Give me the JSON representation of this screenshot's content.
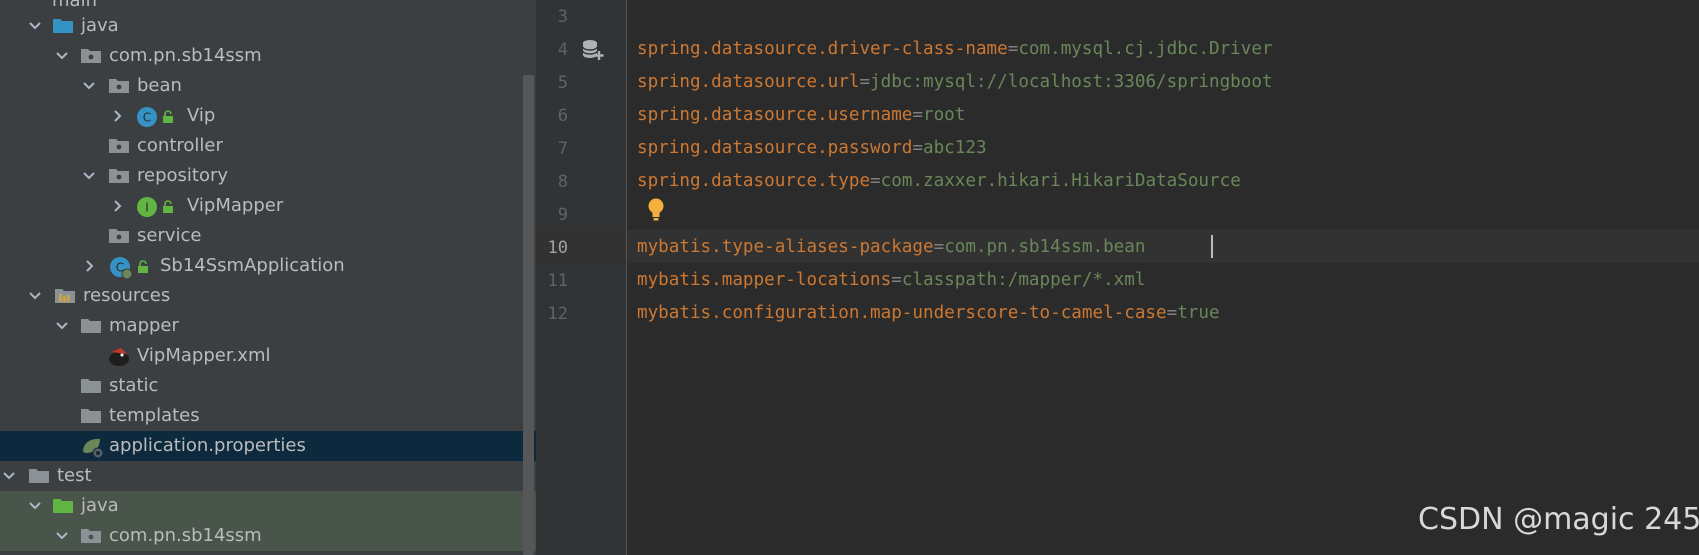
{
  "project_tree": {
    "items": [
      {
        "label": "main",
        "type": "folder"
      },
      {
        "label": "java",
        "type": "source-folder"
      },
      {
        "label": "com.pn.sb14ssm",
        "type": "package"
      },
      {
        "label": "bean",
        "type": "package"
      },
      {
        "label": "Vip",
        "type": "class"
      },
      {
        "label": "controller",
        "type": "package"
      },
      {
        "label": "repository",
        "type": "package"
      },
      {
        "label": "VipMapper",
        "type": "interface"
      },
      {
        "label": "service",
        "type": "package"
      },
      {
        "label": "Sb14SsmApplication",
        "type": "spring-boot-app"
      },
      {
        "label": "resources",
        "type": "resources-folder"
      },
      {
        "label": "mapper",
        "type": "folder"
      },
      {
        "label": "VipMapper.xml",
        "type": "mybatis-xml"
      },
      {
        "label": "static",
        "type": "folder"
      },
      {
        "label": "templates",
        "type": "folder"
      },
      {
        "label": "application.properties",
        "type": "spring-properties",
        "selected": true
      },
      {
        "label": "test",
        "type": "folder"
      },
      {
        "label": "java",
        "type": "test-source-folder"
      },
      {
        "label": "com.pn.sb14ssm",
        "type": "package"
      }
    ]
  },
  "editor": {
    "file": "application.properties",
    "current_line": "10",
    "line_numbers": [
      "3",
      "4",
      "5",
      "6",
      "7",
      "8",
      "9",
      "10",
      "11",
      "12"
    ],
    "lines": [
      {
        "key": "spring.datasource.driver-class-name",
        "eq": "=",
        "value": "com.mysql.cj.jdbc.Driver"
      },
      {
        "key": "spring.datasource.url",
        "eq": "=",
        "value": "jdbc:mysql://localhost:3306/springboot"
      },
      {
        "key": "spring.datasource.username",
        "eq": "=",
        "value": "root"
      },
      {
        "key": "spring.datasource.password",
        "eq": "=",
        "value": "abc123"
      },
      {
        "key": "spring.datasource.type",
        "eq": "=",
        "value": "com.zaxxer.hikari.HikariDataSource"
      },
      {
        "key": "mybatis.type-aliases-package",
        "eq": "=",
        "value": "com.pn.sb14ssm.bean"
      },
      {
        "key": "mybatis.mapper-locations",
        "eq": "=",
        "value": "classpath:/mapper/*.xml"
      },
      {
        "key": "mybatis.configuration.map-underscore-to-camel-case",
        "eq": "=",
        "value": "true"
      }
    ],
    "gutter_icons": [
      "database-add-icon",
      "intention-bulb-icon"
    ]
  },
  "colors": {
    "key": "#cc7832",
    "value": "#6a8759",
    "tree_background": "#3c3f41",
    "editor_background": "#2b2b2b",
    "selection": "#0d293e"
  },
  "watermark": "CSDN @magic 245"
}
